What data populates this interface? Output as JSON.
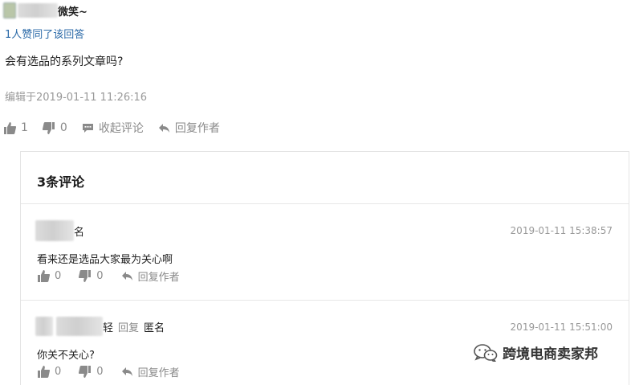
{
  "answer": {
    "author_suffix": "微笑~",
    "liked_text": "1人赞同了该回答",
    "content": "会有选品的系列文章吗?",
    "edited_text": "编辑于2019-01-11 11:26:16",
    "actions": {
      "upvote_count": "1",
      "downvote_count": "0",
      "collapse_label": "收起评论",
      "reply_author_label": "回复作者"
    }
  },
  "comments_panel": {
    "title": "3条评论",
    "comments": [
      {
        "author_suffix": "名",
        "time": "2019-01-11 15:38:57",
        "text": "看来还是选品大家最为关心啊",
        "upvote_count": "0",
        "downvote_count": "0",
        "reply_author_label": "回复作者"
      },
      {
        "author_suffix": "轻",
        "reply_word": "回复",
        "reply_to": "匿名",
        "time": "2019-01-11 15:51:00",
        "text": "你关不关心?",
        "upvote_count": "0",
        "downvote_count": "0",
        "reply_author_label": "回复作者"
      }
    ]
  },
  "watermark": {
    "text": "跨境电商卖家邦"
  }
}
